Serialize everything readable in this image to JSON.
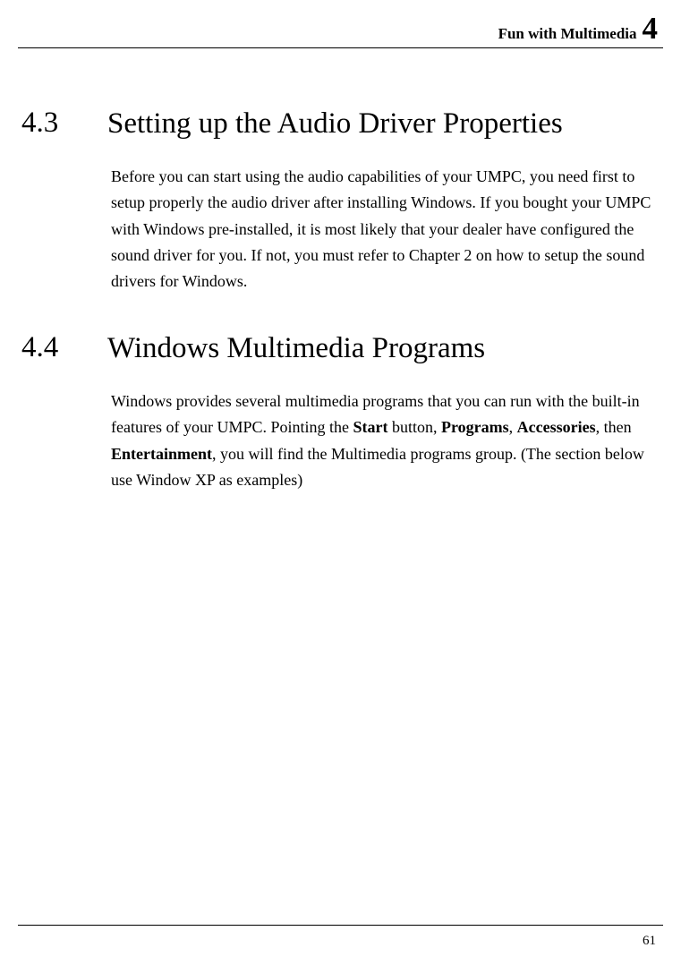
{
  "header": {
    "title": "Fun with Multimedia",
    "chapterNumber": "4"
  },
  "sections": [
    {
      "number": "4.3",
      "title": "Setting up the Audio Driver Properties",
      "paragraph": "Before you can start using the audio capabilities of your UMPC, you need first to setup properly the audio driver after installing Windows. If you bought your UMPC with Windows pre-installed, it is most likely that your dealer have configured the sound driver for you. If not, you must refer to Chapter 2 on how to setup the sound drivers for Windows."
    },
    {
      "number": "4.4",
      "title": "Windows Multimedia Programs",
      "paragraph_parts": {
        "t0": "Windows provides several multimedia programs that you can run with the built-in features of your UMPC. Pointing the ",
        "b0": "Start",
        "t1": " button, ",
        "b1": "Programs",
        "t2": ", ",
        "b2": "Accessories",
        "t3": ", then ",
        "b3": "Entertainment",
        "t4": ", you will find the Multimedia programs group. (The section below use Window XP as examples)"
      }
    }
  ],
  "footer": {
    "pageNumber": "61"
  }
}
